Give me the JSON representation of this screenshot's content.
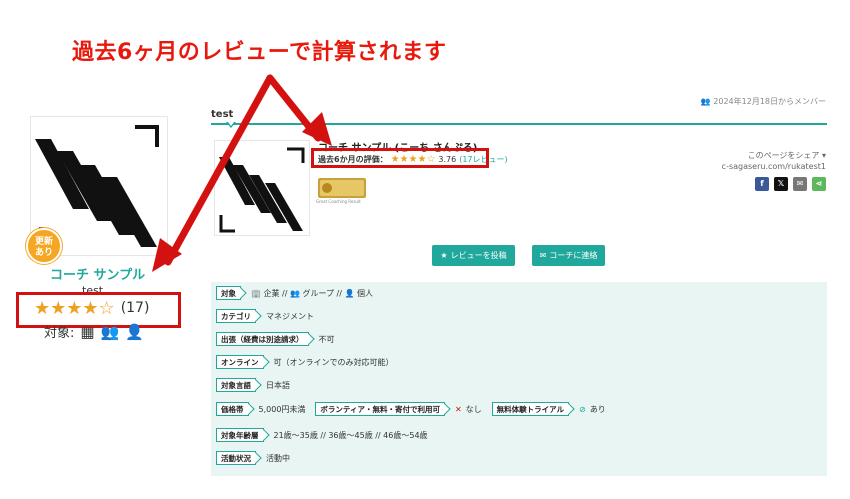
{
  "annotation": {
    "title": "過去6ヶ月のレビューで計算されます",
    "color": "#e8190c"
  },
  "left_card": {
    "badge": "更新\nあり",
    "badge_line1": "更新",
    "badge_line2": "あり",
    "coach_name": "コーチ サンプル",
    "subtitle": "test",
    "rating_stars": "★★★★☆",
    "rating_count": "(17)",
    "target_label": "対象:"
  },
  "header": {
    "member_since": "2024年12月18日からメンバー",
    "page_tab": "test"
  },
  "profile": {
    "name": "コーチ サンプル (こーち さんぷる)",
    "rating_label": "過去6か月の評価：",
    "rating_stars": "★★★★☆",
    "rating_value": "3.76",
    "rating_link": "(17レビュー)",
    "badge_caption": "Great Coaching Result"
  },
  "share": {
    "label": "このページをシェア ▾",
    "url": "c-sagaseru.com/rukatest1",
    "buttons": [
      "f",
      "𝕏",
      "✉",
      "⋖"
    ]
  },
  "actions": {
    "review_button": "レビューを投稿",
    "contact_button": "コーチに連絡"
  },
  "info": {
    "target": {
      "label": "対象",
      "value": "🏢 企業 //  👥 グループ  //  👤 個人"
    },
    "category": {
      "label": "カテゴリ",
      "value": "マネジメント"
    },
    "travel": {
      "label": "出張（経費は別途請求）",
      "value": "不可"
    },
    "online": {
      "label": "オンライン",
      "value": "可（オンラインでのみ対応可能）"
    },
    "language": {
      "label": "対象言語",
      "value": "日本語"
    },
    "price": {
      "label": "価格帯",
      "value": "5,000円未満"
    },
    "volunteer": {
      "label": "ボランティア・無料・寄付で利用可",
      "mark": "✕",
      "value": "なし"
    },
    "trial": {
      "label": "無料体験トライアル",
      "mark": "⊘",
      "value": "あり"
    },
    "ages": {
      "label": "対象年齢層",
      "value": "21歳〜35歳  //   36歳〜45歳  //   46歳〜54歳"
    },
    "status": {
      "label": "活動状況",
      "value": "活動中"
    }
  },
  "colors": {
    "accent": "#1fa89b",
    "star": "#f0a020",
    "highlight_red": "#d41111",
    "panel_bg": "#e8f5f3",
    "badge_orange": "#f5a623"
  }
}
